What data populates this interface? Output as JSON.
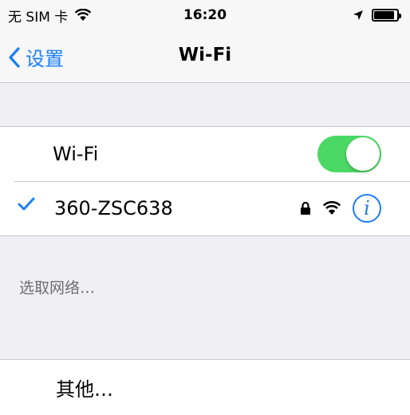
{
  "status_bar": {
    "carrier": "无 SIM 卡",
    "time": "16:20",
    "battery_level": 0.9
  },
  "nav": {
    "back_label": "设置",
    "title": "Wi-Fi"
  },
  "wifi": {
    "label": "Wi-Fi",
    "enabled": true
  },
  "connected_network": {
    "name": "360-ZSC638",
    "info_glyph": "i"
  },
  "choose_network_header": "选取网络…",
  "other": {
    "label": "其他…"
  },
  "colors": {
    "accent": "#1a7ef7",
    "toggle_on": "#4cd864"
  }
}
